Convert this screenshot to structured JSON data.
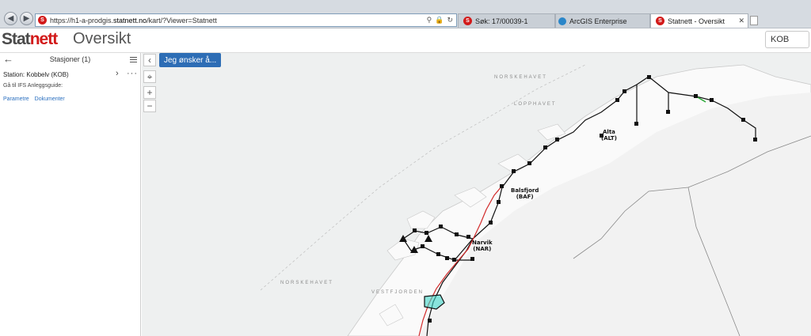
{
  "browser": {
    "url_prefix": "https://h1-a-prodgis.",
    "url_domain": "statnett.no",
    "url_path": "/kart/?Viewer=Statnett",
    "tabs": [
      {
        "label": "Søk: 17/00039-1"
      },
      {
        "label": "ArcGIS Enterprise"
      },
      {
        "label": "Statnett - Oversikt"
      }
    ]
  },
  "header": {
    "logo_part1": "Stat",
    "logo_part2": "nett",
    "title": "Oversikt",
    "search_value": "KOB"
  },
  "panel": {
    "title": "Stasjoner (1)",
    "station": "Station: Kobbelv (KOB)",
    "guide": "Gå til IFS Anleggsguide:",
    "links": [
      "Parametre",
      "Dokumenter"
    ]
  },
  "map": {
    "action_button": "Jeg ønsker å...",
    "sea_labels": [
      "NORSKEHAVET",
      "LOPPHAVET",
      "NORSKEHAVET",
      "VESTFJORDEN"
    ],
    "stations": [
      {
        "name": "Alta",
        "code": "(ALT)"
      },
      {
        "name": "Balsfjord",
        "code": "(BAF)"
      },
      {
        "name": "Narvik",
        "code": "(NAR)"
      }
    ]
  },
  "colors": {
    "accent": "#2d6db5",
    "brand_red": "#d21a1a",
    "line_red": "#d22a2a"
  }
}
